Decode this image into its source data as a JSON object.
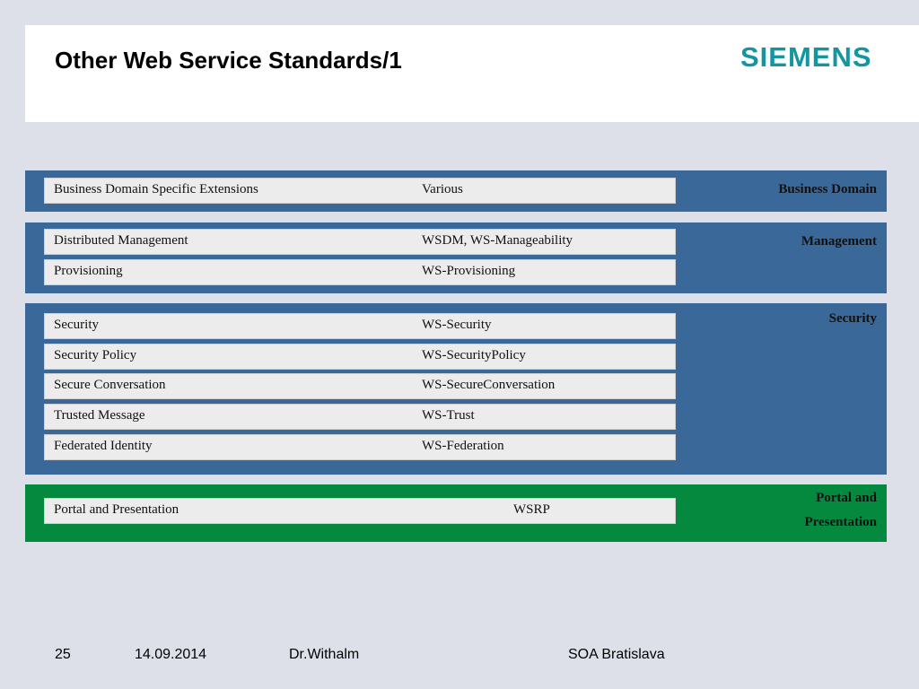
{
  "header": {
    "title": "Other Web Service Standards/1",
    "logo_text": "SIEMENS",
    "logo_color": "#1496a0"
  },
  "colors": {
    "blue_band": "#3a6899",
    "green_band": "#04893f",
    "row_bg": "#ececec",
    "page_bg": "#dde0e8"
  },
  "groups": [
    {
      "label": "Business Domain",
      "rows": [
        {
          "name": "Business Domain Specific Extensions",
          "standard": "Various"
        }
      ]
    },
    {
      "label": "Management",
      "rows": [
        {
          "name": "Distributed Management",
          "standard": "WSDM, WS-Manageability"
        },
        {
          "name": "Provisioning",
          "standard": "WS-Provisioning"
        }
      ]
    },
    {
      "label": "Security",
      "rows": [
        {
          "name": "Security",
          "standard": "WS-Security"
        },
        {
          "name": "Security Policy",
          "standard": "WS-SecurityPolicy"
        },
        {
          "name": "Secure Conversation",
          "standard": "WS-SecureConversation"
        },
        {
          "name": "Trusted Message",
          "standard": "WS-Trust"
        },
        {
          "name": "Federated Identity",
          "standard": "WS-Federation"
        }
      ]
    },
    {
      "label": "Portal and Presentation",
      "rows": [
        {
          "name": "Portal and Presentation",
          "standard": "WSRP"
        }
      ]
    }
  ],
  "footer": {
    "slide_number": "25",
    "date": "14.09.2014",
    "author": "Dr.Withalm",
    "event": "SOA Bratislava"
  }
}
